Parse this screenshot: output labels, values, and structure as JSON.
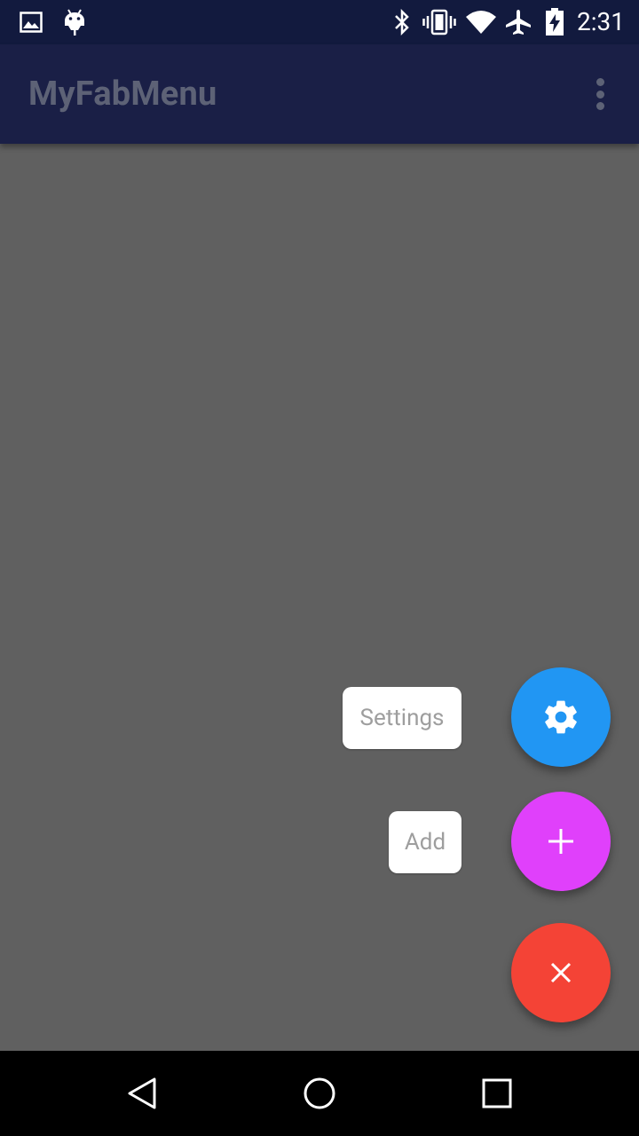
{
  "status_bar": {
    "time": "2:31",
    "left_icons": [
      "image-icon",
      "android-debug-icon"
    ],
    "right_icons": [
      "bluetooth-icon",
      "vibrate-icon",
      "wifi-icon",
      "airplane-mode-icon",
      "battery-charging-icon"
    ]
  },
  "app_bar": {
    "title": "MyFabMenu",
    "overflow_icon": "more-vert-icon"
  },
  "fab_menu": {
    "items": [
      {
        "label": "Settings",
        "icon": "gear-icon",
        "color": "#2196f3"
      },
      {
        "label": "Add",
        "icon": "plus-icon",
        "color": "#e040fb"
      }
    ],
    "main_button": {
      "icon": "close-icon",
      "color": "#f44336"
    }
  },
  "nav_bar": {
    "buttons": [
      "back-icon",
      "home-icon",
      "recents-icon"
    ]
  },
  "colors": {
    "status_bar": "#121a3e",
    "app_bar": "#1a1f46",
    "scrim": "#606060"
  }
}
